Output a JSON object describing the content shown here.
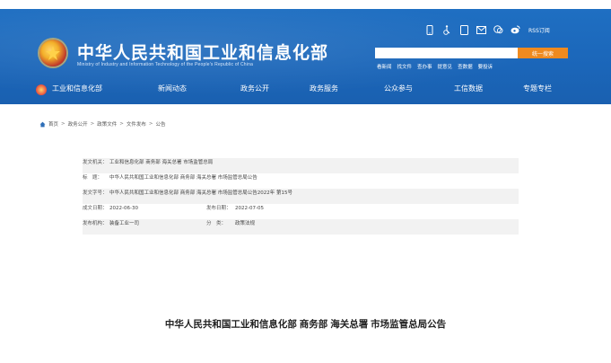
{
  "header": {
    "title": "中华人民共和国工业和信息化部",
    "subtitle": "Ministry of Industry and Information Technology of the People's Republic of China",
    "colors": {
      "brand_blue": "#1b66b9",
      "search_orange": "#ef8a1f"
    },
    "icons": [
      "mobile-icon",
      "accessibility-icon",
      "tablet-icon",
      "mail-icon",
      "wechat-icon",
      "weibo-icon"
    ],
    "rss_label": "RSS订阅",
    "search": {
      "placeholder": "",
      "button_label": "统一搜索"
    },
    "quick_links": [
      "看新闻",
      "找文件",
      "查办事",
      "提意见",
      "查数据",
      "要投诉"
    ]
  },
  "nav": {
    "items": [
      "工业和信息化部",
      "新闻动态",
      "政务公开",
      "政务服务",
      "公众参与",
      "工信数据",
      "专题专栏"
    ]
  },
  "breadcrumb": {
    "items": [
      "首页",
      "政务公开",
      "政策文件",
      "文件发布",
      "公告"
    ],
    "separator": ">"
  },
  "meta": {
    "issuer_label": "发文机关：",
    "issuer": "工业和信息化部 商务部 海关总署 市场监管总局",
    "title_label": "标　题：",
    "title": "中华人民共和国工业和信息化部 商务部 海关总署 市场监管总局公告",
    "docno_label": "发文字号：",
    "docno": "中华人民共和国工业和信息化部 商务部 海关总署 市场监管总局公告2022年 第15号",
    "created_label": "成文日期：",
    "created": "2022-06-30",
    "published_label": "发布日期：",
    "published": "2022-07-05",
    "org_label": "发布机构：",
    "org": "装备工业一司",
    "category_label": "分　类：",
    "category": "政策法规"
  },
  "document": {
    "title": "中华人民共和国工业和信息化部 商务部 海关总署 市场监管总局公告"
  }
}
